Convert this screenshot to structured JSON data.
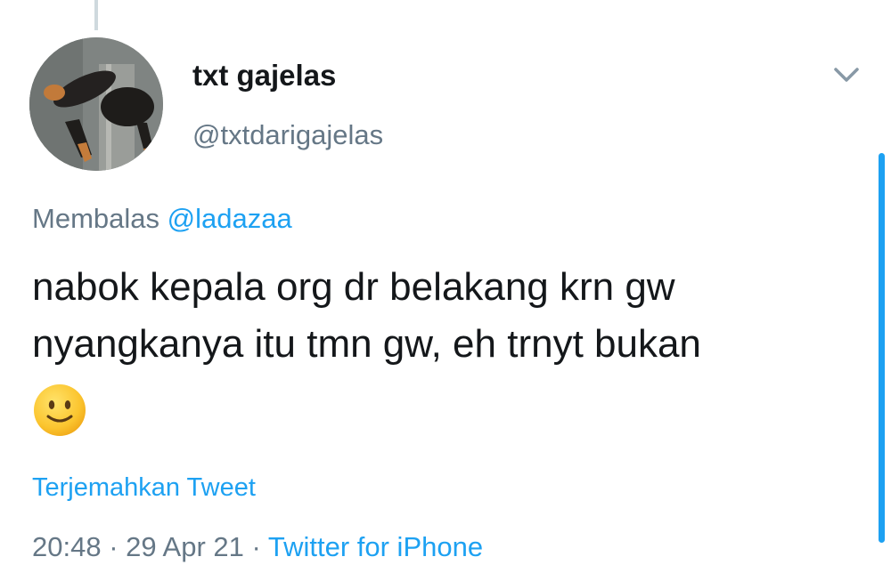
{
  "user": {
    "display_name": "txt gajelas",
    "handle": "@txtdarigajelas"
  },
  "reply": {
    "prefix": "Membalas",
    "mention": "@ladazaa"
  },
  "tweet": {
    "text": "nabok kepala org dr belakang krn gw nyangkanya itu tmn gw, eh trnyt bukan",
    "emoji": "slightly-smiling-face"
  },
  "translate_label": "Terjemahkan Tweet",
  "meta": {
    "time": "20:48",
    "separator": " · ",
    "date": "29 Apr 21",
    "source": "Twitter for iPhone"
  },
  "icons": {
    "caret": "chevron-down-icon",
    "avatar": "dog-avatar"
  },
  "colors": {
    "link": "#1da1f2",
    "text": "#14171a",
    "muted": "#657786"
  }
}
